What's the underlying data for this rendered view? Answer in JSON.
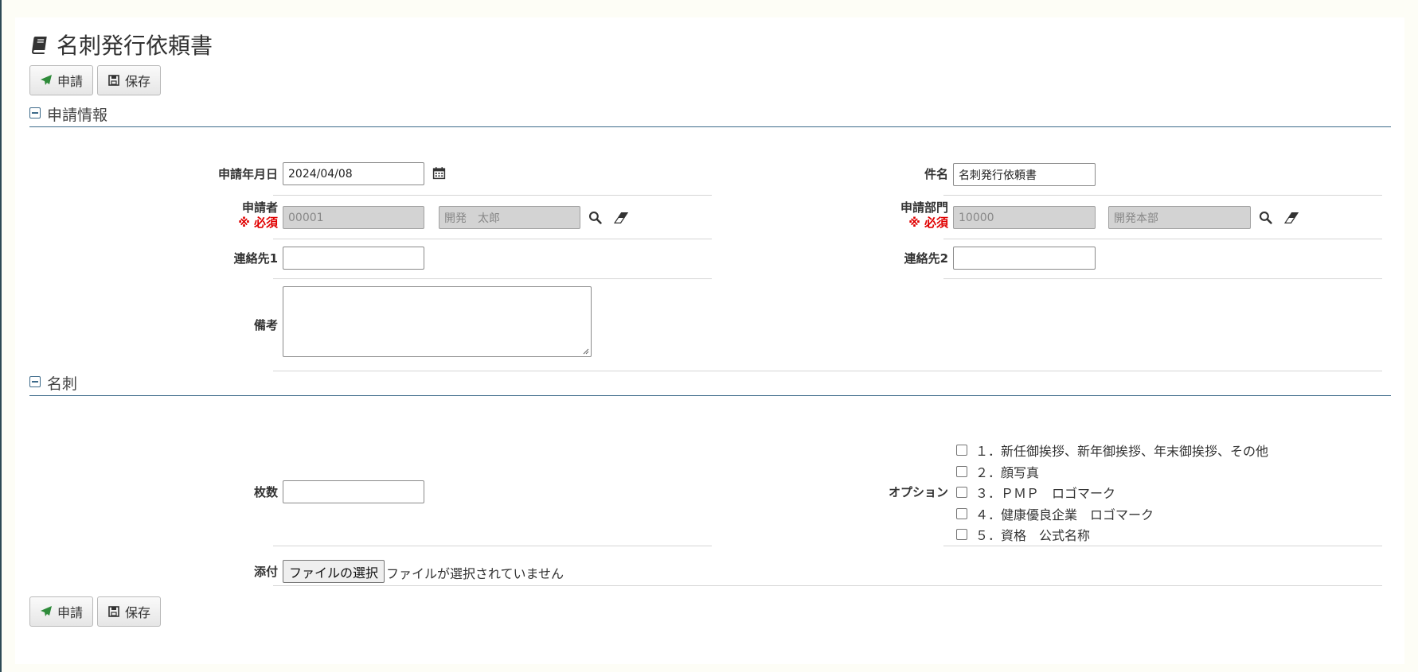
{
  "page": {
    "title": "名刺発行依頼書"
  },
  "toolbar": {
    "apply_label": "申請",
    "save_label": "保存"
  },
  "sections": {
    "application": {
      "title": "申請情報"
    },
    "card": {
      "title": "名刺"
    }
  },
  "application": {
    "date": {
      "label": "申請年月日",
      "value": "2024/04/08"
    },
    "subject": {
      "label": "件名",
      "value": "名刺発行依頼書"
    },
    "applicant": {
      "label": "申請者",
      "required": "※ 必須",
      "code": "00001",
      "name": "開発　太郎"
    },
    "department": {
      "label": "申請部門",
      "required": "※ 必須",
      "code": "10000",
      "name": "開発本部"
    },
    "contact1": {
      "label": "連絡先1",
      "value": ""
    },
    "contact2": {
      "label": "連絡先2",
      "value": ""
    },
    "remarks": {
      "label": "備考",
      "value": ""
    }
  },
  "card": {
    "quantity": {
      "label": "枚数",
      "value": ""
    },
    "options": {
      "label": "オプション",
      "items": [
        {
          "label": "１．新任御挨拶、新年御挨拶、年末御挨拶、その他",
          "checked": false
        },
        {
          "label": "２．顔写真",
          "checked": false
        },
        {
          "label": "３．ＰＭＰ　ロゴマーク",
          "checked": false
        },
        {
          "label": "４．健康優良企業　ロゴマーク",
          "checked": false
        },
        {
          "label": "５．資格　公式名称",
          "checked": false
        }
      ]
    },
    "attachment": {
      "label": "添付",
      "button_label": "ファイルの選択",
      "status": "ファイルが選択されていません"
    }
  },
  "colors": {
    "accent": "#3d6a8a",
    "required": "#e00000",
    "send_icon": "#2e8b3a"
  },
  "icons": [
    "book-icon",
    "send-icon",
    "save-icon",
    "calendar-icon",
    "search-icon",
    "eraser-icon",
    "collapse-icon"
  ]
}
